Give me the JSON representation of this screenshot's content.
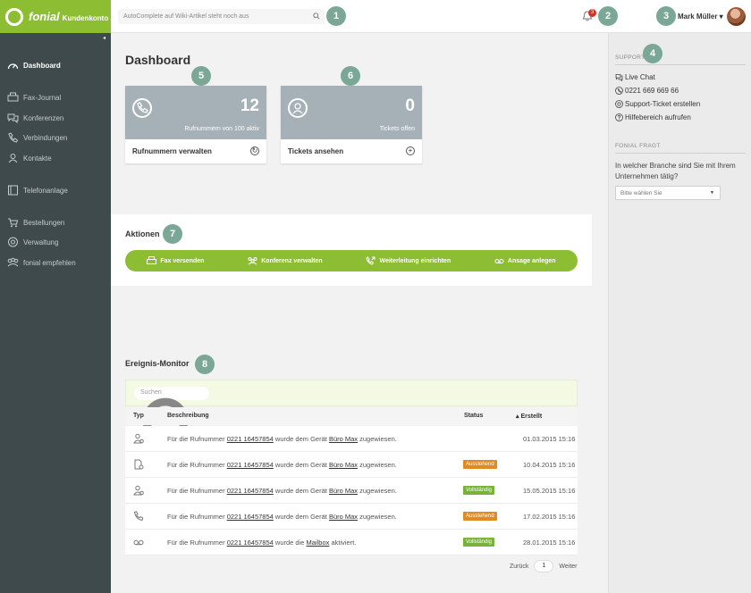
{
  "brand": {
    "name": "fonial",
    "sub": "Kundenkonto"
  },
  "search": {
    "placeholder": "AutoComplete auf Wiki-Artikel steht noch aus"
  },
  "notifications": {
    "count": "3"
  },
  "user": {
    "name": "Mark Müller ▾"
  },
  "markers": [
    "1",
    "2",
    "3",
    "4",
    "5",
    "6",
    "7",
    "8"
  ],
  "sidebar": {
    "collapse": "◂",
    "items": [
      {
        "label": "Dashboard",
        "icon": "speedometer-icon"
      },
      {
        "label": "Fax-Journal",
        "icon": "fax-icon"
      },
      {
        "label": "Konferenzen",
        "icon": "conference-icon"
      },
      {
        "label": "Verbindungen",
        "icon": "phone-icon"
      },
      {
        "label": "Kontakte",
        "icon": "contacts-icon"
      },
      {
        "label": "Telefonanlage",
        "icon": "pbx-icon"
      },
      {
        "label": "Bestellungen",
        "icon": "cart-icon"
      },
      {
        "label": "Verwaltung",
        "icon": "gear-icon"
      },
      {
        "label": "fonial empfehlen",
        "icon": "share-icon"
      }
    ]
  },
  "main": {
    "title": "Dashboard",
    "cards": [
      {
        "number": "12",
        "label": "Rufnummern von 100 aktiv",
        "action": "Rufnummern verwalten",
        "action_icon": "↻"
      },
      {
        "number": "0",
        "label": "Tickets offen",
        "action": "Tickets ansehen",
        "action_icon": "+"
      }
    ],
    "actions_title": "Aktionen",
    "actions": [
      {
        "label": "Fax versenden"
      },
      {
        "label": "Konferenz verwalten"
      },
      {
        "label": "Weiterleitung einrichten"
      },
      {
        "label": "Ansage anlegen"
      }
    ],
    "monitor_title": "Ereignis-Monitor",
    "filter_placeholder": "Suchen",
    "columns": {
      "type": "Typ",
      "description": "Beschreibung",
      "status": "Status",
      "date": "▴ Erstellt"
    },
    "rows": [
      {
        "pre": "Für die Rufnummer ",
        "number": "0221 16457854",
        "mid": " wurde dem Gerät ",
        "target": "Büro Max",
        "post": " zugewiesen.",
        "status": "",
        "status_type": "",
        "date": "01.03.2015 15:16"
      },
      {
        "pre": "Für die Rufnummer ",
        "number": "0221 16457854",
        "mid": " wurde dem Gerät ",
        "target": "Büro Max",
        "post": " zugewiesen.",
        "status": "Ausstehend",
        "status_type": "pending",
        "date": "10.04.2015 15:16"
      },
      {
        "pre": "Für die Rufnummer ",
        "number": "0221 16457854",
        "mid": " wurde dem Gerät ",
        "target": "Büro Max",
        "post": " zugewiesen.",
        "status": "Vollständig",
        "status_type": "done",
        "date": "15.05.2015 15:16"
      },
      {
        "pre": "Für die Rufnummer ",
        "number": "0221 16457854",
        "mid": " wurde dem Gerät ",
        "target": "Büro Max",
        "post": " zugewiesen.",
        "status": "Ausstehend",
        "status_type": "pending",
        "date": "17.02.2015 15:16"
      },
      {
        "pre": "Für die Rufnummer ",
        "number": "0221 16457854",
        "mid": " wurde die ",
        "target": "Mailbox",
        "post": " aktiviert.",
        "status": "Vollständig",
        "status_type": "done",
        "date": "28.01.2015 15:16"
      }
    ],
    "pager": {
      "prev": "Zurück",
      "page": "1",
      "next": "Weiter"
    }
  },
  "rail": {
    "support_head": "Support",
    "links": [
      {
        "label": "Live Chat"
      },
      {
        "label": "0221 669 669 66"
      },
      {
        "label": "Support-Ticket erstellen"
      },
      {
        "label": "Hilfebereich aufrufen"
      }
    ],
    "ask_head": "fonial fragt",
    "question": "In welcher Branche sind Sie mit Ihrem Unternehmen tätig?",
    "select_placeholder": "Bitte wählen Sie",
    "select_caret": "▼"
  },
  "colors": {
    "brand_green": "#8cbd32",
    "sidebar": "#3e4a4b",
    "card_gray": "#a5b1b6",
    "pending": "#e08a23",
    "done": "#77b23a",
    "marker": "#7ba797"
  }
}
